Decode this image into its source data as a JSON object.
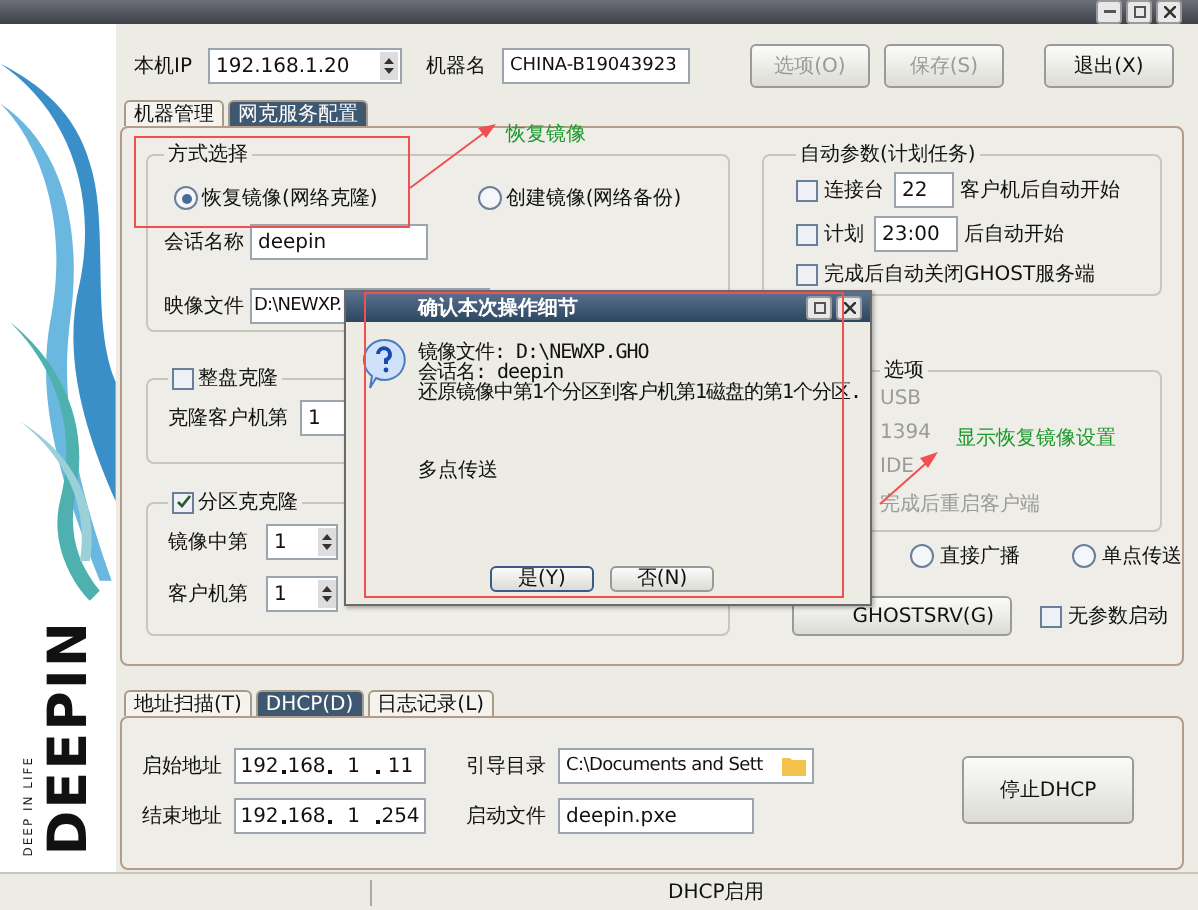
{
  "header": {
    "ip_label": "本机IP",
    "ip_value": "192.168.1.20",
    "name_label": "机器名",
    "name_value": "CHINA-B19043923",
    "buttons": [
      {
        "label": "选项(O)",
        "disabled": true
      },
      {
        "label": "保存(S)",
        "disabled": true
      },
      {
        "label": "退出(X)",
        "disabled": false
      }
    ]
  },
  "tabs": [
    {
      "label": "机器管理",
      "selected": false
    },
    {
      "label": "网克服务配置",
      "selected": true
    }
  ],
  "mode_group": {
    "title": "方式选择",
    "options": [
      {
        "label": "恢复镜像(网络克隆)",
        "selected": true
      },
      {
        "label": "创建镜像(网络备份)",
        "selected": false
      }
    ],
    "session_label": "会话名称",
    "session_value": "deepin",
    "image_label": "映像文件",
    "image_value": "D:\\NEWXP."
  },
  "whole_disk": {
    "title": "整盘克隆",
    "checked": false,
    "client_label": "克隆客户机第",
    "client_value": "1"
  },
  "partition": {
    "title": "分区克克隆",
    "checked": true,
    "rows": [
      {
        "label": "镜像中第",
        "value": "1"
      },
      {
        "label": "客户机第",
        "value": "1"
      }
    ]
  },
  "auto": {
    "title": "自动参数(计划任务)",
    "rows": [
      {
        "checked": false,
        "label": "连接台",
        "value": "22",
        "suffix": "客户机后自动开始"
      },
      {
        "checked": false,
        "label": "计划",
        "value": "23:00",
        "suffix": "后自动开始"
      },
      {
        "checked": false,
        "label": "完成后自动关闭GHOST服务端"
      }
    ]
  },
  "options_group": {
    "title": "选项",
    "items": [
      {
        "label": "USB",
        "disabled": true
      },
      {
        "label": "1394",
        "disabled": true
      },
      {
        "label": "IDE",
        "disabled": true
      },
      {
        "label": "完成后重启客户端",
        "disabled": true
      }
    ]
  },
  "transfer": [
    {
      "label": "直接广播",
      "selected": false
    },
    {
      "label": "单点传送",
      "selected": false
    }
  ],
  "ghostsrv_button": "GHOSTSRV(G)",
  "no_param": {
    "label": "无参数启动",
    "checked": false
  },
  "annotations": [
    "恢复镜像",
    "显示恢复镜像设置"
  ],
  "dialog": {
    "title": "确认本次操作细节",
    "lines": [
      "镜像文件:  D:\\NEWXP.GHO",
      "会话名:   deepin",
      "还原镜像中第1个分区到客户机第1磁盘的第1个分区."
    ],
    "mode": "多点传送",
    "buttons": [
      "是(Y)",
      "否(N)"
    ]
  },
  "bottom_tabs": [
    {
      "label": "地址扫描(T)",
      "selected": false
    },
    {
      "label": "DHCP(D)",
      "selected": true
    },
    {
      "label": "日志记录(L)",
      "selected": false
    }
  ],
  "dhcp": {
    "start_label": "启始地址",
    "start_ip": [
      "192",
      "168",
      "1",
      "11"
    ],
    "end_label": "结束地址",
    "end_ip": [
      "192",
      "168",
      "1",
      "254"
    ],
    "boot_dir_label": "引导目录",
    "boot_dir_value": "C:\\Documents and Sett",
    "boot_file_label": "启动文件",
    "boot_file_value": "deepin.pxe",
    "stop_button": "停止DHCP"
  },
  "status_bar": {
    "text": "DHCP启用"
  },
  "sidebar": {
    "logo": "DEEPIN",
    "tagline": "DEEP IN LIFE"
  }
}
